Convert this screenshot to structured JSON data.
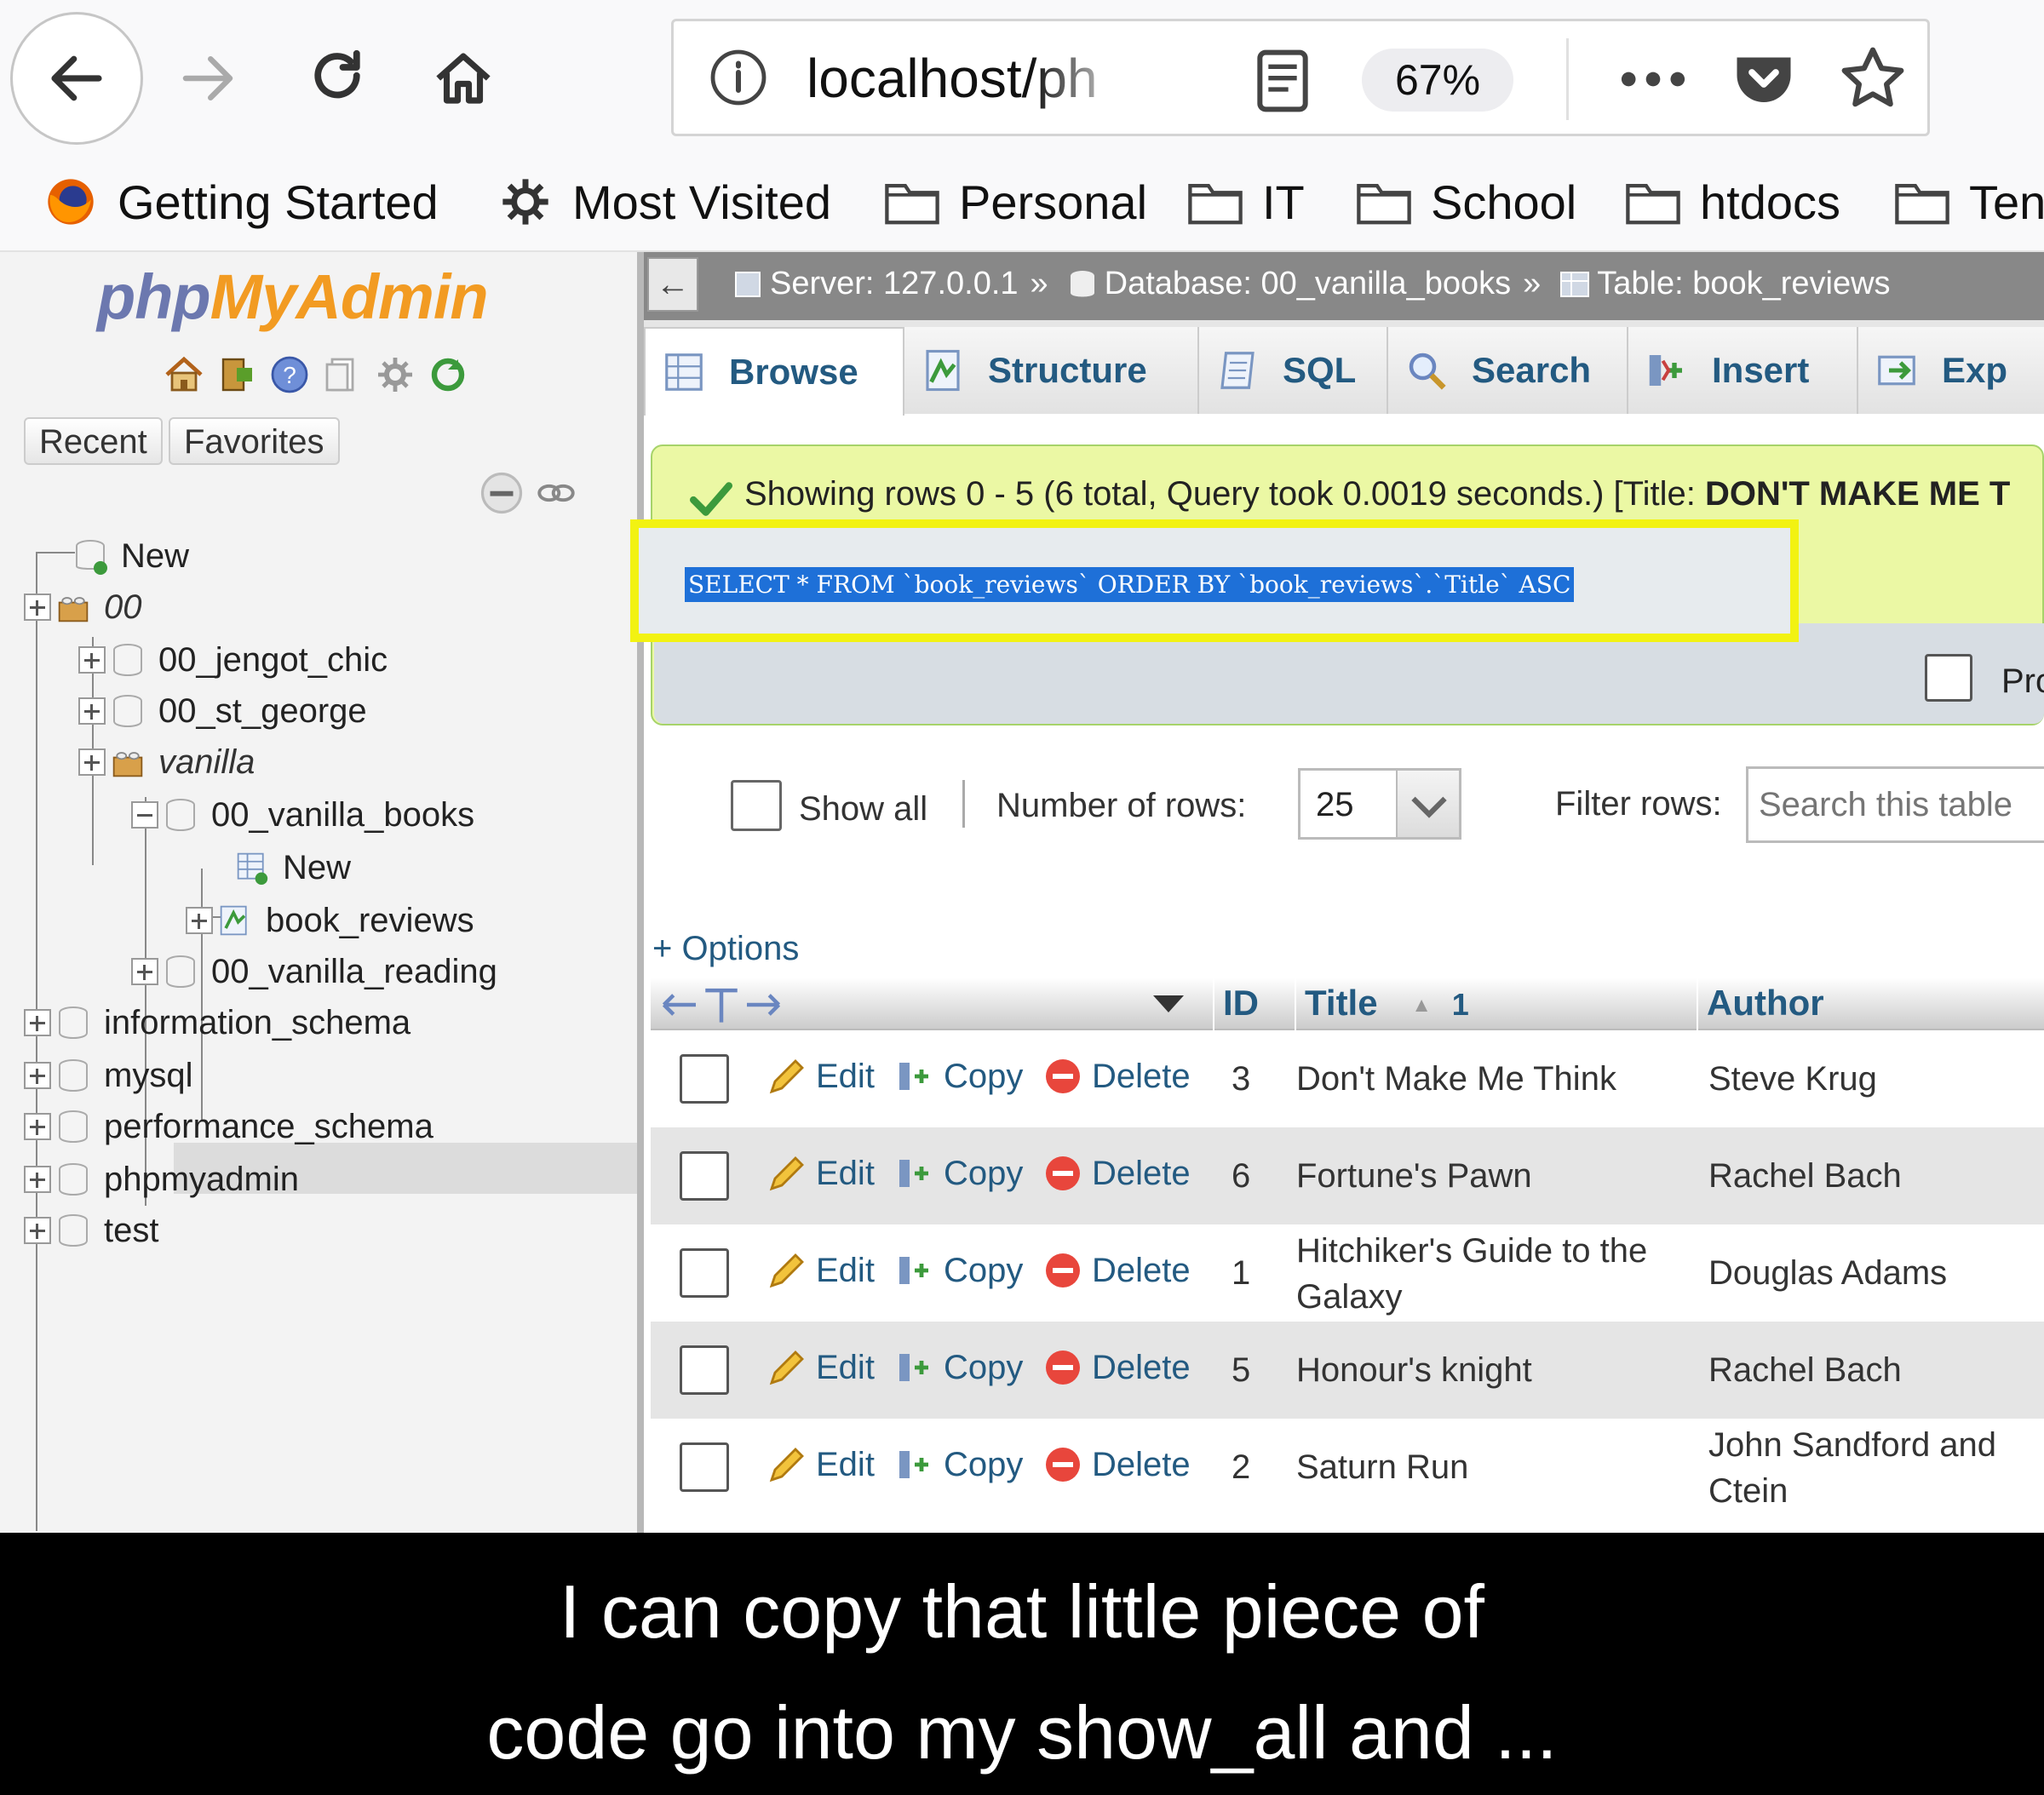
{
  "browser": {
    "url": "localhost/ph",
    "zoom": "67%",
    "bookmarks": [
      "Getting Started",
      "Most Visited",
      "Personal",
      "IT",
      "School",
      "htdocs",
      "Ten"
    ]
  },
  "sidebar": {
    "logo_php": "php",
    "logo_myadmin": "MyAdmin",
    "tabs": [
      "Recent",
      "Favorites"
    ],
    "tree": {
      "new": "New",
      "group_00": "00",
      "jengot": "00_jengot_chic",
      "st_george": "00_st_george",
      "group_vanilla": "vanilla",
      "vanilla_books": "00_vanilla_books",
      "books_new": "New",
      "book_reviews": "book_reviews",
      "vanilla_reading": "00_vanilla_reading",
      "information_schema": "information_schema",
      "mysql": "mysql",
      "performance_schema": "performance_schema",
      "phpmyadmin": "phpmyadmin",
      "test": "test"
    }
  },
  "breadcrumb": {
    "server": "Server: 127.0.0.1",
    "database": "Database: 00_vanilla_books",
    "table": "Table: book_reviews",
    "sep": "»"
  },
  "tabs": [
    "Browse",
    "Structure",
    "SQL",
    "Search",
    "Insert",
    "Exp"
  ],
  "message": {
    "text": "Showing rows 0 - 5 (6 total, Query took 0.0019 seconds.) [Title: ",
    "bold": "DON'T MAKE ME T"
  },
  "sql": "SELECT * FROM `book_reviews` ORDER BY `book_reviews`.`Title` ASC",
  "profiling_label": "Pro",
  "controls": {
    "show_all": "Show all",
    "number_of_rows_label": "Number of rows:",
    "number_of_rows_value": "25",
    "filter_label": "Filter rows:",
    "filter_placeholder": "Search this table"
  },
  "options_link": "+ Options",
  "table": {
    "headers": {
      "id": "ID",
      "title": "Title",
      "title_sort": "1",
      "author": "Author"
    },
    "actions": {
      "edit": "Edit",
      "copy": "Copy",
      "delete": "Delete"
    },
    "rows": [
      {
        "id": "3",
        "title": "Don't Make Me Think",
        "author": "Steve Krug"
      },
      {
        "id": "6",
        "title": "Fortune's Pawn",
        "author": "Rachel Bach"
      },
      {
        "id": "1",
        "title": "Hitchiker's Guide to the Galaxy",
        "author": "Douglas Adams"
      },
      {
        "id": "5",
        "title": "Honour's knight",
        "author": "Rachel Bach"
      },
      {
        "id": "2",
        "title": "Saturn Run",
        "author": "John Sandford and Ctein"
      }
    ]
  },
  "caption": {
    "line1": "I can copy that little piece of",
    "line2": "code go into my show_all and ..."
  },
  "colors": {
    "highlight_border": "#f2f212",
    "link": "#235a81",
    "success_bg": "#ebf8a4"
  }
}
